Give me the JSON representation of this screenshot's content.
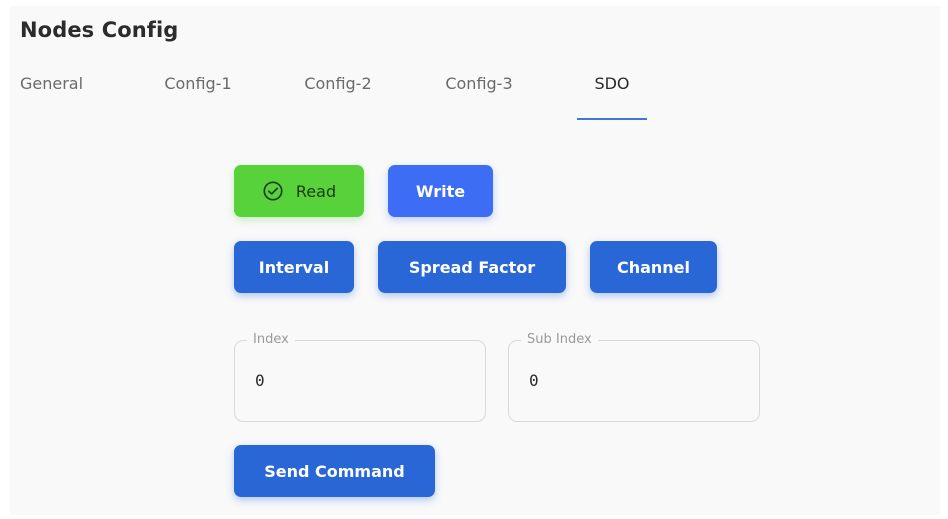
{
  "page": {
    "title": "Nodes Config"
  },
  "tabs": [
    {
      "label": "General",
      "active": false
    },
    {
      "label": "Config-1",
      "active": false
    },
    {
      "label": "Config-2",
      "active": false
    },
    {
      "label": "Config-3",
      "active": false
    },
    {
      "label": "SDO",
      "active": true
    }
  ],
  "mode_buttons": {
    "read_label": "Read",
    "read_icon": "check-circle-icon",
    "write_label": "Write"
  },
  "param_buttons": {
    "interval_label": "Interval",
    "spread_factor_label": "Spread Factor",
    "channel_label": "Channel"
  },
  "fields": {
    "index": {
      "label": "Index",
      "value": "0"
    },
    "sub_index": {
      "label": "Sub Index",
      "value": "0"
    }
  },
  "send_button": {
    "label": "Send Command"
  },
  "colors": {
    "primary": "#2a67d6",
    "write": "#3d6cf5",
    "read_active": "#58d23a",
    "tab_indicator": "#3f78d8"
  }
}
